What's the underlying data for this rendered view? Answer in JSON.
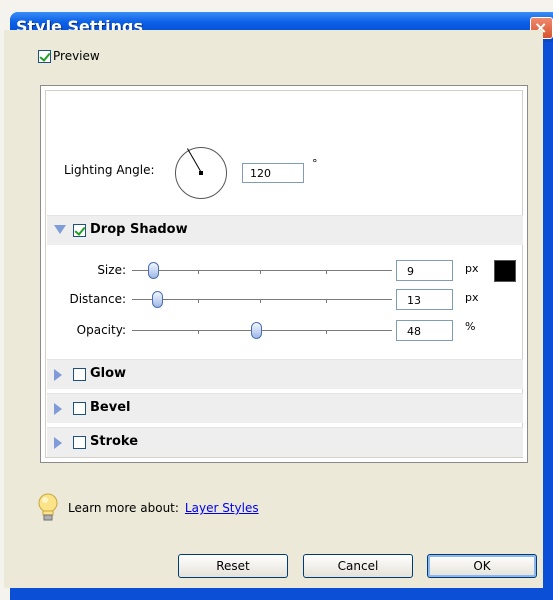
{
  "window": {
    "title": "Style Settings",
    "close_glyph": "×"
  },
  "preview": {
    "label": "Preview",
    "checked": true
  },
  "lighting": {
    "label": "Lighting Angle:",
    "value": "120",
    "unit": "°",
    "angle_degrees": 120
  },
  "sections": {
    "drop_shadow": {
      "label": "Drop Shadow",
      "checked": true,
      "expanded": true
    },
    "glow": {
      "label": "Glow",
      "checked": false,
      "expanded": false
    },
    "bevel": {
      "label": "Bevel",
      "checked": false,
      "expanded": false
    },
    "stroke": {
      "label": "Stroke",
      "checked": false,
      "expanded": false
    }
  },
  "drop_shadow": {
    "size": {
      "label": "Size:",
      "value": "9",
      "unit": "px"
    },
    "distance": {
      "label": "Distance:",
      "value": "13",
      "unit": "px"
    },
    "opacity": {
      "label": "Opacity:",
      "value": "48",
      "unit": "%"
    },
    "color": "#000000"
  },
  "footer": {
    "learn_text": "Learn more about:",
    "link_text": "Layer Styles"
  },
  "buttons": {
    "reset": "Reset",
    "cancel": "Cancel",
    "ok": "OK"
  },
  "icons": [
    "close-icon",
    "check-icon",
    "dial-icon",
    "triangle-down-icon",
    "triangle-right-icon",
    "lightbulb-icon"
  ]
}
